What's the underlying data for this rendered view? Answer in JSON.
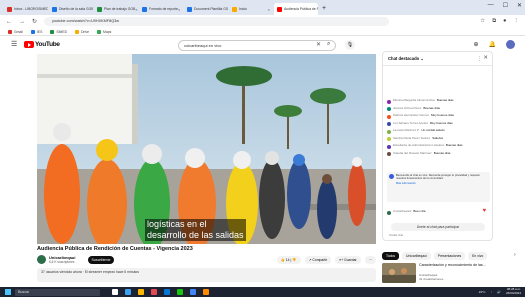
{
  "browser": {
    "tabs": [
      {
        "label": "Inbox - LIBOROSIMEDIA0001",
        "color": "#d93025",
        "active": false
      },
      {
        "label": "Diseño de la sala GGB",
        "color": "#1a73e8",
        "active": false
      },
      {
        "label": "Plan de trabajo GGB",
        "color": "#1e8e3e",
        "active": false
      },
      {
        "label": "Formato de reporte",
        "color": "#1a73e8",
        "active": false
      },
      {
        "label": "Document Plantilla GST",
        "color": "#1a73e8",
        "active": false
      },
      {
        "label": "Inicio",
        "color": "#f9ab00",
        "active": false
      },
      {
        "label": "Audiencia Pública de R",
        "color": "#ff0000",
        "active": true
      }
    ],
    "url": "youtube.com/watch?v=U9HXKMF8Q3w",
    "bookmarks": [
      {
        "label": "Gmail",
        "color": "#d93025"
      },
      {
        "label": "IES",
        "color": "#1a73e8"
      },
      {
        "label": "SIMED",
        "color": "#1e8e3e"
      },
      {
        "label": "Drive",
        "color": "#f9ab00"
      },
      {
        "label": "Maps",
        "color": "#34a853"
      }
    ]
  },
  "youtube": {
    "logo_text": "YouTube",
    "search_value": "colcaribeaqui en vivo",
    "video": {
      "caption_line1": "logísticas en el",
      "caption_line2": "desarrollo de las salidas",
      "title": "Audiencia Pública de Rendición de Cuentas - Vigencia 2023",
      "channel": "Unicaribeqaui",
      "subscribers": "6,6 K suscriptores",
      "subscribe_label": "Suscribirme",
      "likes": "14",
      "share_label": "Compartir",
      "save_label": "Guardar",
      "description": "37 usuarios viéndolo ahora · El streamer empezó hace 6 minutos"
    },
    "chat": {
      "title": "Chat destacado",
      "messages": [
        {
          "author": "Mónica Margarita Almanza Roa",
          "text": "Buenas días",
          "color": "#8e24aa"
        },
        {
          "author": "Jessica Ochoa Pérez",
          "text": "Buenas días",
          "color": "#00897b"
        },
        {
          "author": "Patricia Hernández Gómez",
          "text": "Muy buenos días",
          "color": "#f4511e"
        },
        {
          "author": "Luz Adriana Torres Acosta",
          "text": "Muy buenos días",
          "color": "#3949ab"
        },
        {
          "author": "Leonela Martínez P.",
          "text": "Un cordial saludo",
          "color": "#7cb342"
        },
        {
          "author": "Sandra Paola Pérez Suárez",
          "text": "Saludos",
          "color": "#c0ca33"
        },
        {
          "author": "Estudiante de Administración Hotelera",
          "text": "Buenas días",
          "color": "#5e35b1"
        },
        {
          "author": "Claudia del Rosario Martínez",
          "text": "Buenas días",
          "color": "#6d4c41"
        }
      ],
      "notice": "Bienvenido al chat en vivo. Recuerda proteger tu privacidad y respetar nuestros lineamientos de la comunidad.",
      "notice_more": "Más información",
      "last_author": "Unicaribeqaui",
      "last_text": "Buen día",
      "input_placeholder": "Únete al chat para participar",
      "footer": "Ocultar chat",
      "hide_label": "Ocultar chat"
    },
    "chips": [
      "Todos",
      "Unicaribeqaui",
      "Presentaciones",
      "En vivo"
    ],
    "recommended": {
      "title": "Caracterización y reconocimiento de las...",
      "channel": "Unicaribeqaui",
      "meta": "41 visualizaciones"
    }
  },
  "taskbar": {
    "search_placeholder": "Buscar",
    "tray_temp": "24°C",
    "time": "08:28 a.m.",
    "date": "26/04/2024",
    "app_colors": [
      "#ffffff",
      "#3aa0f0",
      "#ffb900",
      "#e74856",
      "#0078d4",
      "#16c60c",
      "#4285f4",
      "#ff8c00"
    ]
  }
}
